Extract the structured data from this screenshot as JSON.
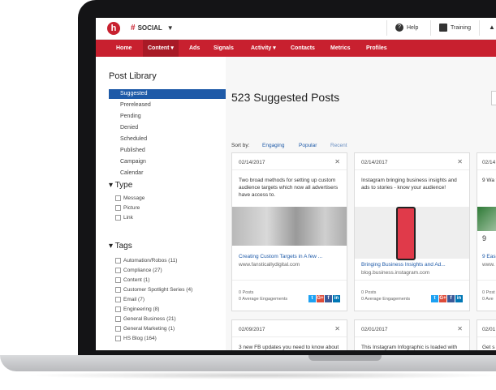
{
  "topbar": {
    "account": "SOCIAL",
    "help": "Help",
    "training": "Training",
    "notifications": "N"
  },
  "nav": [
    "Home",
    "Content",
    "Ads",
    "Signals",
    "Activity",
    "Contacts",
    "Metrics",
    "Profiles"
  ],
  "sidebar": {
    "title": "Post Library",
    "library_items": [
      "Suggested",
      "Prereleased",
      "Pending",
      "Denied",
      "Scheduled",
      "Published",
      "Campaign",
      "Calendar"
    ],
    "type_heading": "Type",
    "types": [
      "Message",
      "Picture",
      "Link"
    ],
    "tags_heading": "Tags",
    "tags": [
      "Automation/Robos (11)",
      "Compliance (27)",
      "Content (1)",
      "Customer Spotlight Series (4)",
      "Email (7)",
      "Engineering (8)",
      "General Business (21)",
      "General Marketing (1)",
      "HS Blog (164)"
    ]
  },
  "main": {
    "title": "523 Suggested Posts",
    "sort_label": "Sort by:",
    "sort_options": [
      "Engaging",
      "Popular",
      "Recent"
    ]
  },
  "cards": [
    {
      "date": "02/14/2017",
      "text": "Two broad methods for setting up custom audience targets which now all advertisers have access to.",
      "link": "Creating Custom Targets in A few ...",
      "domain": "www.fansticallydigital.com",
      "posts": "0 Posts",
      "engagements": "0 Average Engagements"
    },
    {
      "date": "02/14/2017",
      "text": "Instagram bringing business insights and ads to stories - know your audience!",
      "link": "Bringing Business Insights and Ad...",
      "domain": "blog.business.instagram.com",
      "posts": "0 Posts",
      "engagements": "0 Average Engagements"
    },
    {
      "date": "02/14",
      "text": "9 Wa for Ne",
      "link": "9 Eas",
      "domain": "www.",
      "posts": "0 Post",
      "engagements": "0 Ave"
    },
    {
      "date": "02/09/2017",
      "text": "3 new FB updates you need to know about"
    },
    {
      "date": "02/01/2017",
      "text": "This Instagram Infographic is loaded with interesting facts about the network. Did you know 70% of"
    },
    {
      "date": "02/01",
      "text": "Get s it's ne"
    }
  ],
  "card_extras": {
    "img3_text": "9",
    "close": "✕"
  },
  "socials": [
    "t",
    "G+",
    "f",
    "in"
  ],
  "icons": {
    "help": "?",
    "training": "▭",
    "notifications": "▲"
  }
}
